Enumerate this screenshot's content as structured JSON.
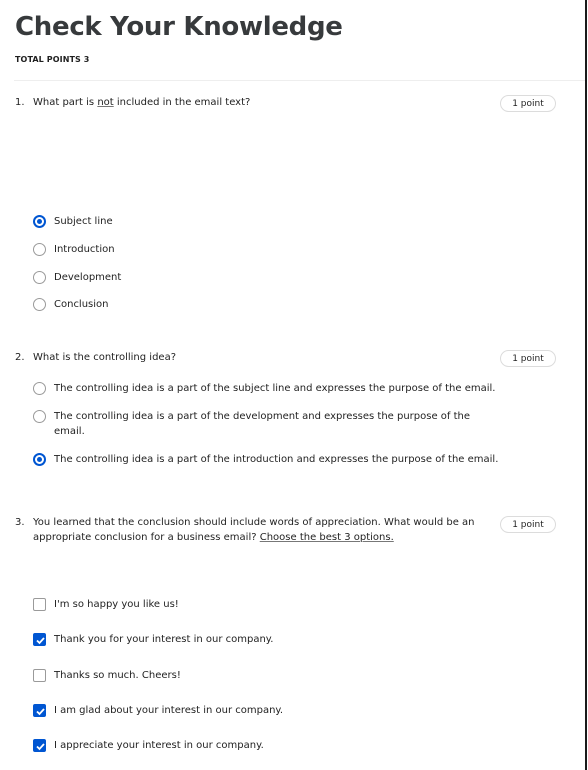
{
  "header": {
    "title": "Check Your Knowledge",
    "total_points": "TOTAL POINTS 3"
  },
  "colors": {
    "accent": "#0056d2",
    "text": "#1f1f1f",
    "title": "#373a3c"
  },
  "questions": [
    {
      "number": "1.",
      "text_before": "What part is ",
      "text_underlined": "not",
      "text_after": " included in the email text?",
      "points": "1 point",
      "type": "radio",
      "options": [
        {
          "label": "Subject line",
          "selected": true
        },
        {
          "label": "Introduction",
          "selected": false
        },
        {
          "label": "Development",
          "selected": false
        },
        {
          "label": "Conclusion",
          "selected": false
        }
      ]
    },
    {
      "number": "2.",
      "text": "What is the controlling idea?",
      "points": "1 point",
      "type": "radio",
      "options": [
        {
          "label": "The controlling idea is a part of the subject line and expresses the purpose of the email.",
          "selected": false
        },
        {
          "label_line1": "The controlling idea is a part of the development and expresses the purpose of the",
          "label_line2": "email.",
          "selected": false
        },
        {
          "label": "The controlling idea is a part of the introduction and expresses the purpose of the email.",
          "selected": true
        }
      ]
    },
    {
      "number": "3.",
      "text_line1": "You learned that the conclusion should include words of appreciation. What would be an",
      "text_line2": "appropriate conclusion for a business email? ",
      "text_link": "Choose the best 3 options.",
      "points": "1 point",
      "type": "checkbox",
      "options": [
        {
          "label": "I'm so happy you like us!",
          "checked": false
        },
        {
          "label": "Thank you for your interest in our company.",
          "checked": true
        },
        {
          "label": "Thanks so much. Cheers!",
          "checked": false
        },
        {
          "label": "I am glad about your interest in our company.",
          "checked": true
        },
        {
          "label": "I appreciate your interest in our company.",
          "checked": true
        }
      ]
    }
  ]
}
